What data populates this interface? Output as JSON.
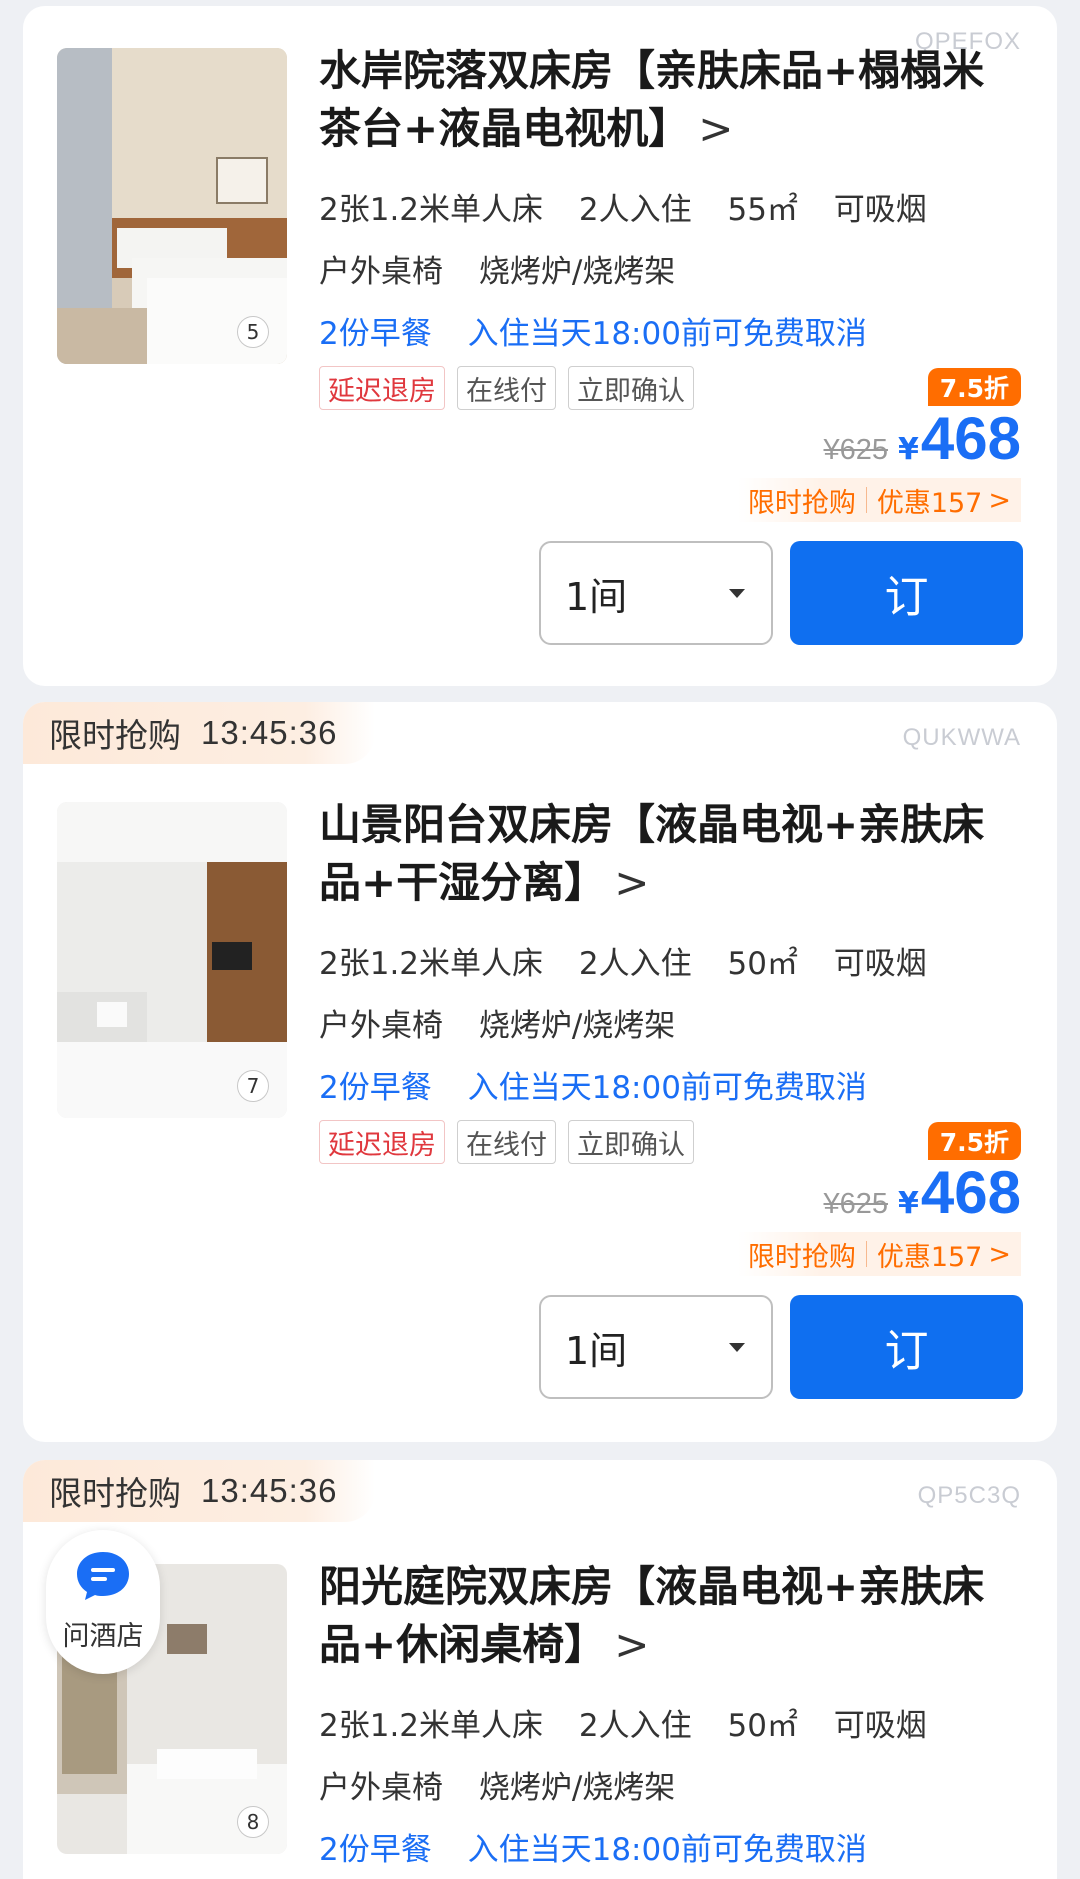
{
  "rooms": [
    {
      "code": "QPEFOX",
      "flash": null,
      "photo_count": "5",
      "title": "水岸院落双床房【亲肤床品+榻榻米茶台+液晶电视机】",
      "specs": [
        "2张1.2米单人床",
        "2人入住",
        "55㎡",
        "可吸烟"
      ],
      "facilities": [
        "户外桌椅",
        "烧烤炉/烧烤架"
      ],
      "policies": [
        "2份早餐",
        "入住当天18:00前可免费取消"
      ],
      "tags": [
        "延迟退房",
        "在线付",
        "立即确认"
      ],
      "discount": "7.5折",
      "old_price": "¥625",
      "currency": "¥",
      "price": "468",
      "promo_label": "限时抢购",
      "promo_saving": "优惠157",
      "qty": "1间",
      "book_label": "订"
    },
    {
      "code": "QUKWWA",
      "flash": {
        "label": "限时抢购",
        "timer": "13:45:36"
      },
      "photo_count": "7",
      "title": "山景阳台双床房【液晶电视+亲肤床品+干湿分离】",
      "specs": [
        "2张1.2米单人床",
        "2人入住",
        "50㎡",
        "可吸烟"
      ],
      "facilities": [
        "户外桌椅",
        "烧烤炉/烧烤架"
      ],
      "policies": [
        "2份早餐",
        "入住当天18:00前可免费取消"
      ],
      "tags": [
        "延迟退房",
        "在线付",
        "立即确认"
      ],
      "discount": "7.5折",
      "old_price": "¥625",
      "currency": "¥",
      "price": "468",
      "promo_label": "限时抢购",
      "promo_saving": "优惠157",
      "qty": "1间",
      "book_label": "订"
    },
    {
      "code": "QP5C3Q",
      "flash": {
        "label": "限时抢购",
        "timer": "13:45:36"
      },
      "photo_count": "8",
      "title": "阳光庭院双床房【液晶电视+亲肤床品+休闲桌椅】",
      "specs": [
        "2张1.2米单人床",
        "2人入住",
        "50㎡",
        "可吸烟"
      ],
      "facilities": [
        "户外桌椅",
        "烧烤炉/烧烤架"
      ],
      "policies": [
        "2份早餐",
        "入住当天18:00前可免费取消"
      ]
    }
  ],
  "ask_hotel": {
    "label": "问酒店",
    "icon": "chat-bubble-icon"
  },
  "colors": {
    "accent_blue": "#0f6ff0",
    "orange": "#ff6d00",
    "red_tag": "#e0383e"
  }
}
